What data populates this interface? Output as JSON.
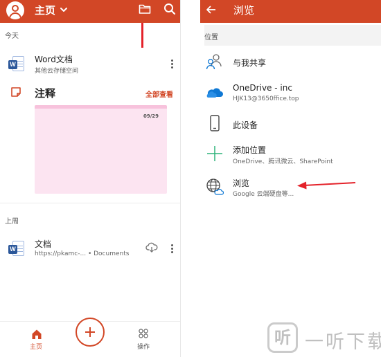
{
  "left": {
    "header": {
      "title": "主页"
    },
    "sections": {
      "today": "今天",
      "last_week": "上周"
    },
    "recent_files": [
      {
        "name": "Word文档",
        "location": "其他云存储空间"
      },
      {
        "name": "文档",
        "location": "https://pkamc-... • Documents"
      }
    ],
    "notes": {
      "title": "注释",
      "see_all": "全部查看",
      "card_date": "09/29"
    },
    "bottom_nav": {
      "home": "主页",
      "actions": "操作"
    }
  },
  "right": {
    "header": {
      "title": "浏览"
    },
    "section_label": "位置",
    "locations": [
      {
        "title": "与我共享",
        "subtitle": "",
        "icon": "shared-people-icon"
      },
      {
        "title": "OneDrive - inc",
        "subtitle": "HJK13@3650ffice.top",
        "icon": "onedrive-cloud-icon"
      },
      {
        "title": "此设备",
        "subtitle": "",
        "icon": "phone-device-icon"
      },
      {
        "title": "添加位置",
        "subtitle": "OneDrive、腾讯微云、SharePoint",
        "icon": "plus-icon"
      },
      {
        "title": "浏览",
        "subtitle": "Google 云端硬盘等...",
        "icon": "globe-cloud-icon"
      }
    ]
  },
  "watermark": {
    "logo": "听",
    "text": "一听下载"
  },
  "colors": {
    "accent": "#d24726",
    "annotation": "#e4222a",
    "note_card": "#fce4f1",
    "word_blue": "#2b579a",
    "onedrive_blue": "#0f78d4",
    "add_green": "#2db37a"
  }
}
